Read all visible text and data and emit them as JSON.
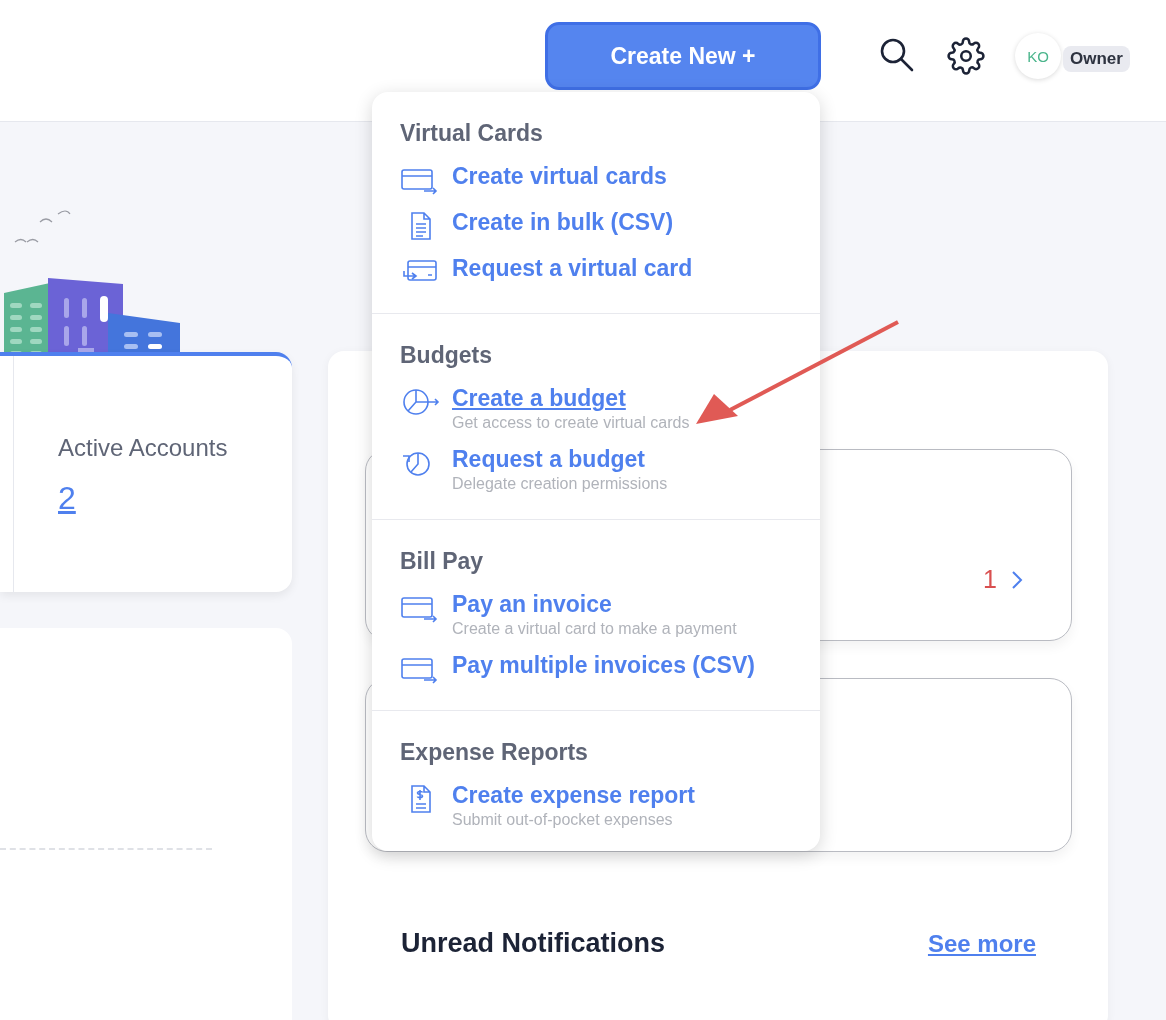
{
  "header": {
    "create_button": "Create New +",
    "avatar": "KO",
    "role_badge": "Owner"
  },
  "accounts_card": {
    "label": "Active Accounts",
    "value": "2"
  },
  "panel": {
    "summary_count": "1",
    "notifications_title": "Unread Notifications",
    "see_more": "See more"
  },
  "menu": {
    "sections": [
      {
        "heading": "Virtual Cards",
        "items": [
          {
            "label": "Create virtual cards",
            "kind": "card-arrow",
            "hovered": false
          },
          {
            "label": "Create in bulk (CSV)",
            "kind": "document",
            "hovered": false
          },
          {
            "label": "Request a virtual card",
            "kind": "card-exchange",
            "hovered": false
          }
        ]
      },
      {
        "heading": "Budgets",
        "items": [
          {
            "label": "Create a budget",
            "subtitle": "Get access to create virtual cards",
            "kind": "pie-arrow",
            "hovered": true
          },
          {
            "label": "Request a budget",
            "subtitle": "Delegate creation permissions",
            "kind": "pie-return",
            "hovered": false
          }
        ]
      },
      {
        "heading": "Bill Pay",
        "items": [
          {
            "label": "Pay an invoice",
            "subtitle": "Create a virtual card to make a payment",
            "kind": "card-arrow",
            "hovered": false
          },
          {
            "label": "Pay multiple invoices (CSV)",
            "kind": "card-arrow",
            "hovered": false
          }
        ]
      },
      {
        "heading": "Expense Reports",
        "items": [
          {
            "label": "Create expense report",
            "subtitle": "Submit out-of-pocket expenses",
            "kind": "receipt",
            "hovered": false
          }
        ]
      }
    ]
  }
}
